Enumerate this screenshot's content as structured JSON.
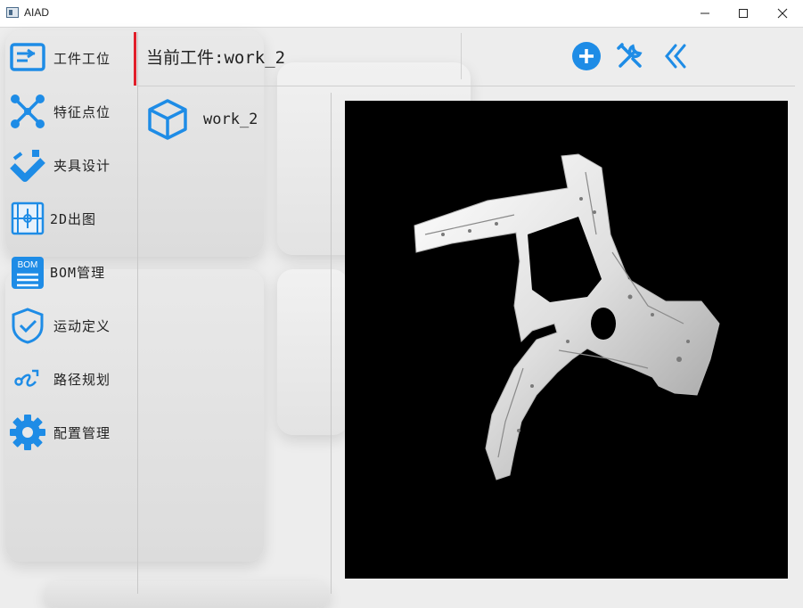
{
  "window": {
    "title": "AIAD"
  },
  "colors": {
    "accent": "#1e8ce6",
    "active_marker": "#e11f2a",
    "viewport_bg": "#000000"
  },
  "sidebar": {
    "items": [
      {
        "label": "工件工位",
        "icon": "workpiece-station-icon",
        "active": true
      },
      {
        "label": "特征点位",
        "icon": "feature-points-icon"
      },
      {
        "label": "夹具设计",
        "icon": "fixture-design-icon"
      },
      {
        "label": "2D出图",
        "icon": "drawing-2d-icon"
      },
      {
        "label": "BOM管理",
        "icon": "bom-icon",
        "badge": "BOM"
      },
      {
        "label": "运动定义",
        "icon": "motion-shield-icon"
      },
      {
        "label": "路径规划",
        "icon": "path-planning-icon"
      },
      {
        "label": "配置管理",
        "icon": "gear-icon"
      }
    ]
  },
  "header": {
    "title": "当前工件:work_2",
    "tools": [
      "add-icon",
      "tools-icon",
      "collapse-icon"
    ]
  },
  "workpieces": [
    {
      "name": "work_2",
      "icon": "cube-icon"
    }
  ],
  "viewport": {
    "content": "3d-part-model"
  }
}
